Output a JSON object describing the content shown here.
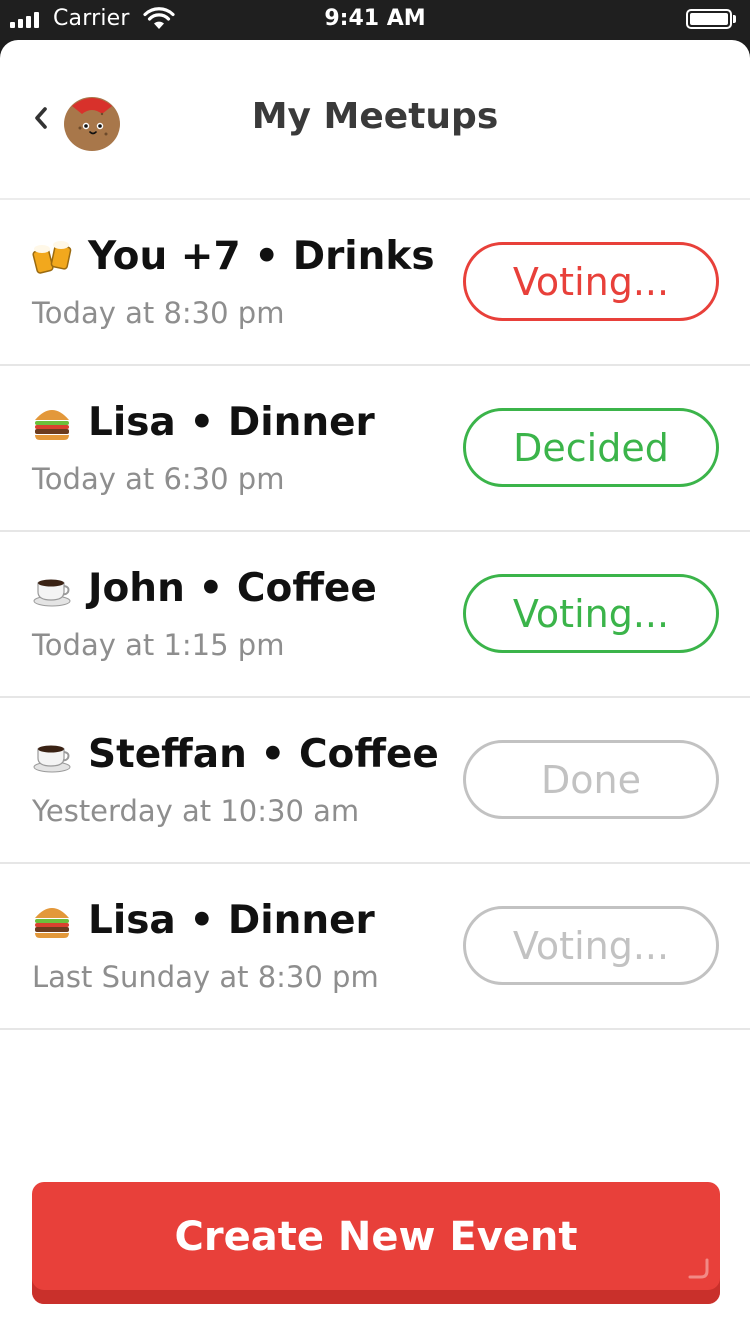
{
  "status_bar": {
    "carrier": "Carrier",
    "time": "9:41 AM"
  },
  "nav": {
    "title": "My Meetups",
    "back_icon": "chevron-left-icon",
    "avatar_icon": "potato-avatar-icon"
  },
  "meetups": [
    {
      "emoji": "beer-mugs-icon",
      "title": "You +7 • Drinks",
      "time": "Today at 8:30 pm",
      "status": "Voting...",
      "status_color": "#e8403a"
    },
    {
      "emoji": "burger-icon",
      "title": "Lisa • Dinner",
      "time": "Today at 6:30 pm",
      "status": "Decided",
      "status_color": "#3bb44a"
    },
    {
      "emoji": "coffee-cup-icon",
      "title": "John • Coffee",
      "time": "Today at 1:15 pm",
      "status": "Voting...",
      "status_color": "#3bb44a"
    },
    {
      "emoji": "coffee-cup-icon",
      "title": "Steffan • Coffee",
      "time": "Yesterday at 10:30 am",
      "status": "Done",
      "status_color": "#c2c2c2"
    },
    {
      "emoji": "burger-icon",
      "title": "Lisa • Dinner",
      "time": "Last Sunday at 8:30 pm",
      "status": "Voting...",
      "status_color": "#c2c2c2"
    }
  ],
  "create_button": {
    "label": "Create New Event",
    "color": "#e8403a"
  }
}
